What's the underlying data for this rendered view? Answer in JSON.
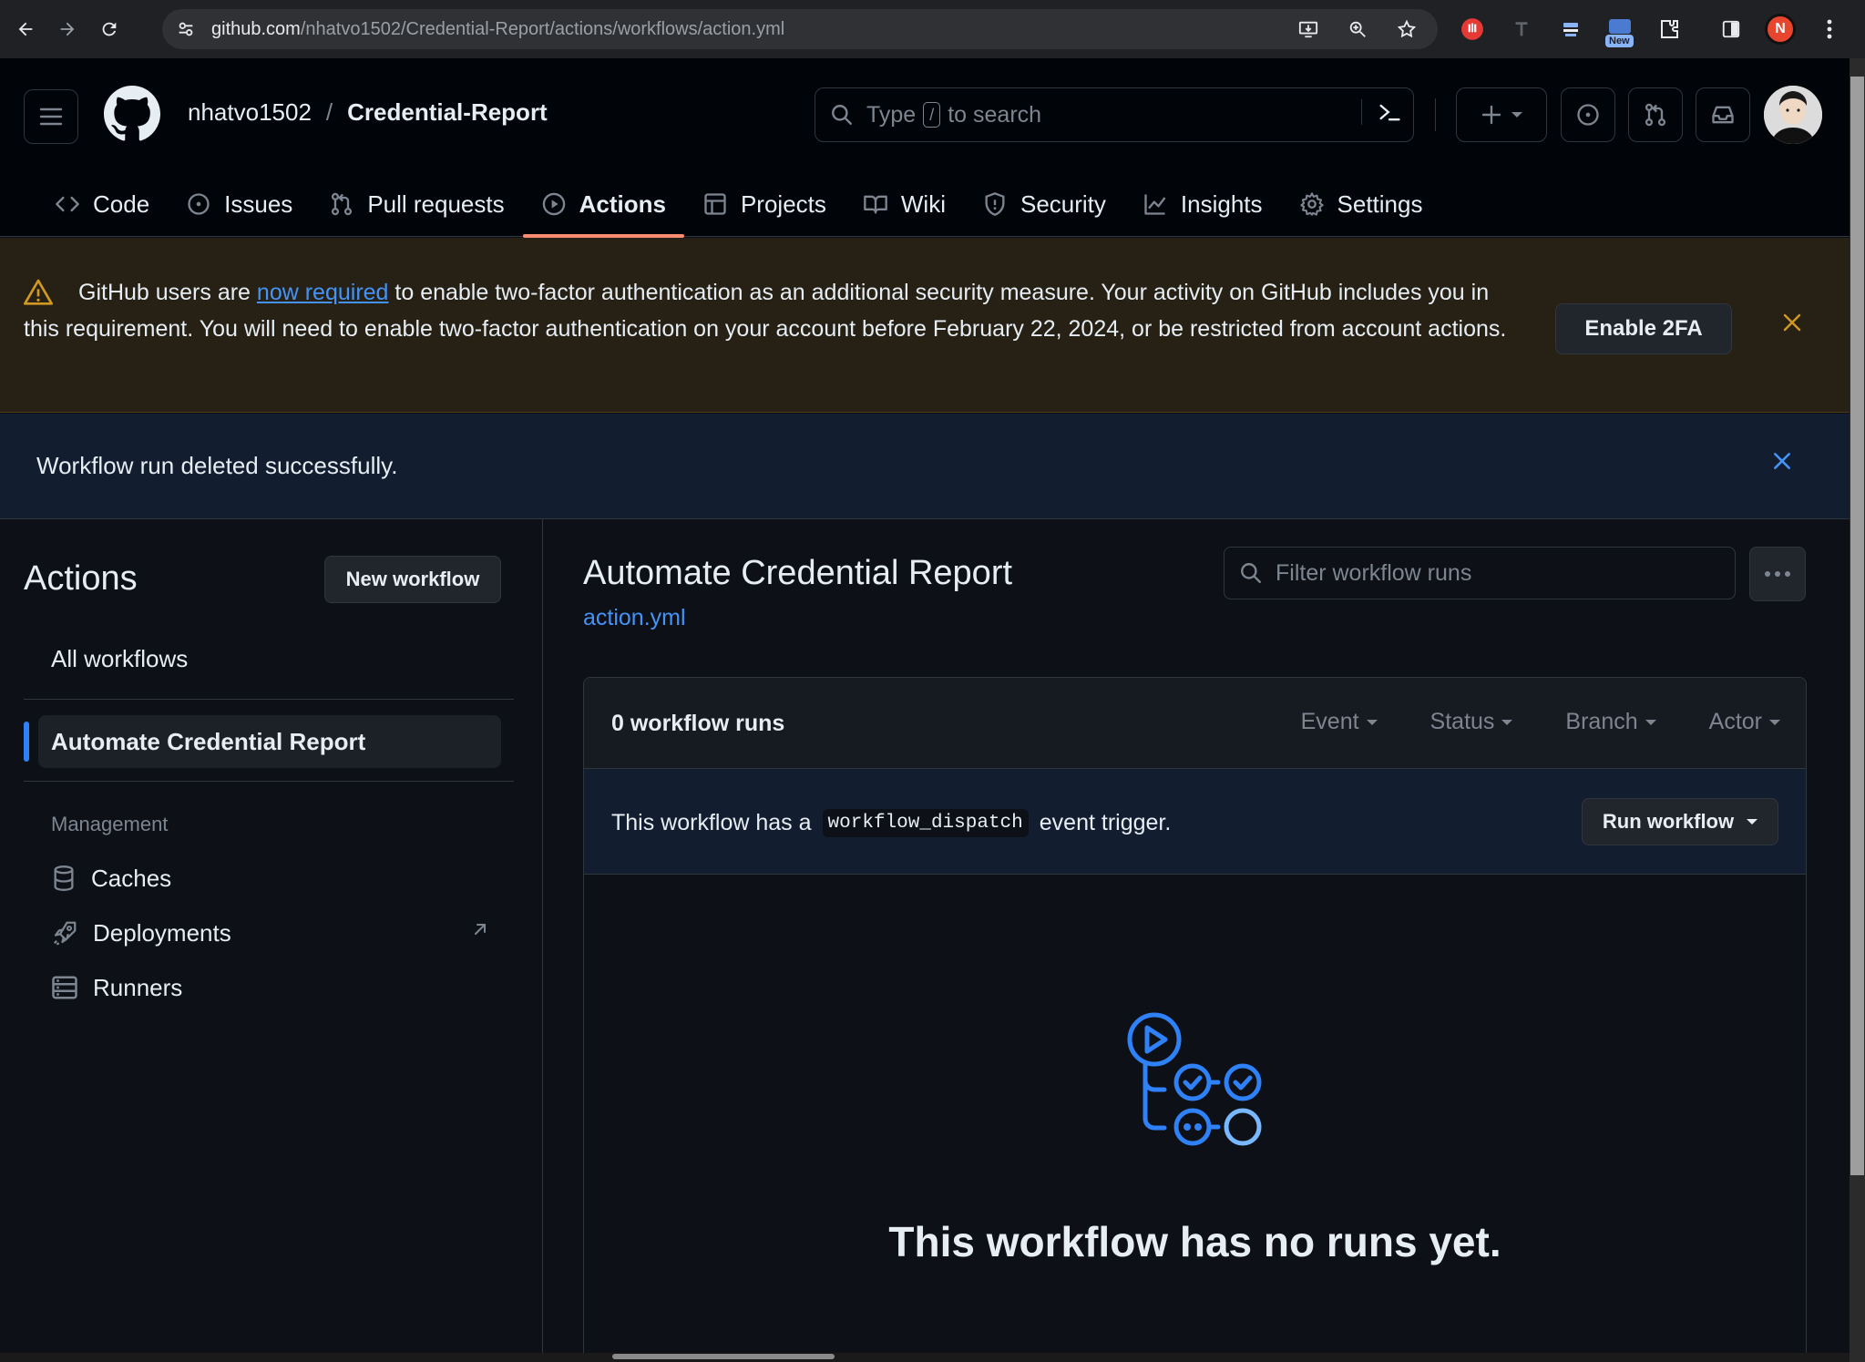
{
  "browser": {
    "url_host": "github.com",
    "url_path": "/nhatvo1502/Credential-Report/actions/workflows/action.yml",
    "profile_initial": "N",
    "extension_badge": "New"
  },
  "header": {
    "owner": "nhatvo1502",
    "separator": "/",
    "repo": "Credential-Report",
    "search_before": "Type",
    "search_key": "/",
    "search_after": "to search"
  },
  "tabs": [
    {
      "label": "Code",
      "icon": "code-icon"
    },
    {
      "label": "Issues",
      "icon": "issue-icon"
    },
    {
      "label": "Pull requests",
      "icon": "pull-request-icon"
    },
    {
      "label": "Actions",
      "icon": "play-icon",
      "active": true
    },
    {
      "label": "Projects",
      "icon": "table-icon"
    },
    {
      "label": "Wiki",
      "icon": "book-icon"
    },
    {
      "label": "Security",
      "icon": "shield-icon"
    },
    {
      "label": "Insights",
      "icon": "graph-icon"
    },
    {
      "label": "Settings",
      "icon": "gear-icon"
    }
  ],
  "warning": {
    "text_before": "GitHub users are ",
    "link": "now required",
    "text_after": " to enable two-factor authentication as an additional security measure. Your activity on GitHub includes you in this requirement. You will need to enable two-factor authentication on your account before February 22, 2024, or be restricted from account actions.",
    "button": "Enable 2FA"
  },
  "flash": {
    "message": "Workflow run deleted successfully."
  },
  "sidebar": {
    "title": "Actions",
    "new_workflow": "New workflow",
    "all_workflows": "All workflows",
    "workflows": [
      "Automate Credential Report"
    ],
    "section_title": "Management",
    "management": [
      {
        "label": "Caches",
        "icon": "database-icon"
      },
      {
        "label": "Deployments",
        "icon": "rocket-icon"
      },
      {
        "label": "Runners",
        "icon": "server-icon"
      }
    ]
  },
  "main": {
    "title": "Automate Credential Report",
    "file": "action.yml",
    "filter_placeholder": "Filter workflow runs",
    "runs_count": "0 workflow runs",
    "filters": [
      "Event",
      "Status",
      "Branch",
      "Actor"
    ],
    "dispatch_before": "This workflow has a",
    "dispatch_code": "workflow_dispatch",
    "dispatch_after": "event trigger.",
    "run_workflow": "Run workflow",
    "empty_title": "This workflow has no runs yet."
  },
  "colors": {
    "accent_blue": "#4493f8",
    "tab_underline": "#fd8c73",
    "warning_icon": "#d29922"
  }
}
